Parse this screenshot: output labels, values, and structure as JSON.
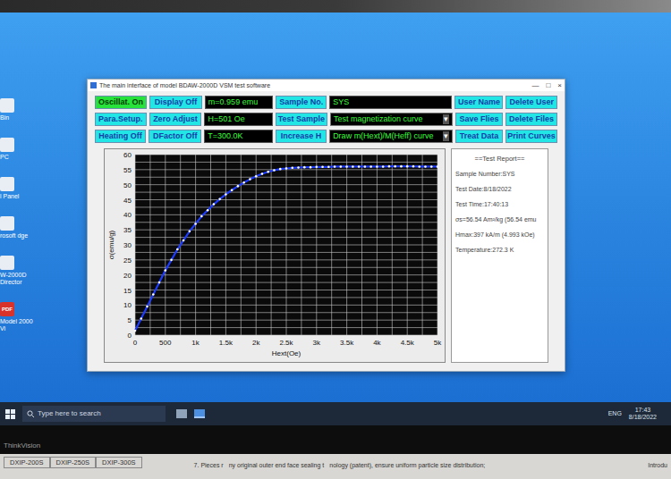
{
  "window": {
    "title": "The main interface of model BDAW-2000D VSM test software",
    "controls": [
      "—",
      "□",
      "×"
    ]
  },
  "desktop_icons": [
    {
      "label": "Bin"
    },
    {
      "label": "PC"
    },
    {
      "label": "l Panel"
    },
    {
      "label": "rosoft dge"
    },
    {
      "label": "W-2000D Director"
    },
    {
      "label": "Model 2000 Vi",
      "badge": "PDF"
    }
  ],
  "toolbar": {
    "rows": [
      [
        {
          "label": "Oscillat. On",
          "kind": "button",
          "active": true
        },
        {
          "label": "Display Off",
          "kind": "button",
          "active": false
        },
        {
          "label": "m=0.959 emu",
          "kind": "value",
          "active": false
        },
        {
          "label": "Sample No.",
          "kind": "button",
          "active": false
        },
        {
          "label": "SYS",
          "kind": "value",
          "active": false
        },
        {
          "label": "User Name",
          "kind": "button",
          "active": false
        },
        {
          "label": "Delete User",
          "kind": "button",
          "active": false
        }
      ],
      [
        {
          "label": "Para.Setup.",
          "kind": "button",
          "active": false
        },
        {
          "label": "Zero Adjust",
          "kind": "button",
          "active": false
        },
        {
          "label": "H=501 Oe",
          "kind": "value",
          "active": false
        },
        {
          "label": "Test Sample",
          "kind": "button",
          "active": false
        },
        {
          "label": "Test magnetization curve",
          "kind": "dropdown",
          "active": false
        },
        {
          "label": "Save Flies",
          "kind": "button",
          "active": false
        },
        {
          "label": "Delete Files",
          "kind": "button",
          "active": false
        }
      ],
      [
        {
          "label": "Heating Off",
          "kind": "button",
          "active": false
        },
        {
          "label": "DFactor Off",
          "kind": "button",
          "active": false
        },
        {
          "label": "T=300.0K",
          "kind": "value",
          "active": false
        },
        {
          "label": "Increase H",
          "kind": "button",
          "active": false
        },
        {
          "label": "Draw m(Hext)/M(Heff) curve",
          "kind": "dropdown",
          "active": false
        },
        {
          "label": "Treat Data",
          "kind": "button",
          "active": false
        },
        {
          "label": "Print Curves",
          "kind": "button",
          "active": false
        }
      ]
    ],
    "dropdown_arrow": "▾"
  },
  "chart": {
    "y_label": "σ(emu/g)",
    "x_label": "Hext(Oe)",
    "y_ticks": [
      {
        "label": "0",
        "value": 0
      },
      {
        "label": "5",
        "value": 5
      },
      {
        "label": "10",
        "value": 10
      },
      {
        "label": "15",
        "value": 15
      },
      {
        "label": "20",
        "value": 20
      },
      {
        "label": "25",
        "value": 25
      },
      {
        "label": "30",
        "value": 30
      },
      {
        "label": "35",
        "value": 35
      },
      {
        "label": "40",
        "value": 40
      },
      {
        "label": "45",
        "value": 45
      },
      {
        "label": "50",
        "value": 50
      },
      {
        "label": "55",
        "value": 55
      },
      {
        "label": "60",
        "value": 60
      }
    ],
    "x_ticks": [
      {
        "label": "0",
        "value": 0
      },
      {
        "label": "500",
        "value": 500
      },
      {
        "label": "1k",
        "value": 1000
      },
      {
        "label": "1.5k",
        "value": 1500
      },
      {
        "label": "2k",
        "value": 2000
      },
      {
        "label": "2.5k",
        "value": 2500
      },
      {
        "label": "3k",
        "value": 3000
      },
      {
        "label": "3.5k",
        "value": 3500
      },
      {
        "label": "4k",
        "value": 4000
      },
      {
        "label": "4.5k",
        "value": 4500
      },
      {
        "label": "5k",
        "value": 5000
      }
    ],
    "series": [
      {
        "name": "m(Hext)",
        "color": "#1e3cff",
        "points": [
          [
            0,
            1.5
          ],
          [
            100,
            5.5
          ],
          [
            200,
            9.5
          ],
          [
            300,
            13.5
          ],
          [
            400,
            17.5
          ],
          [
            500,
            21.5
          ],
          [
            600,
            25
          ],
          [
            700,
            28.5
          ],
          [
            800,
            31.5
          ],
          [
            900,
            34.5
          ],
          [
            1000,
            37
          ],
          [
            1100,
            39.5
          ],
          [
            1200,
            41.5
          ],
          [
            1300,
            43.5
          ],
          [
            1400,
            45.2
          ],
          [
            1500,
            46.8
          ],
          [
            1600,
            48.2
          ],
          [
            1700,
            49.5
          ],
          [
            1800,
            50.7
          ],
          [
            1900,
            51.8
          ],
          [
            2000,
            52.8
          ],
          [
            2100,
            53.6
          ],
          [
            2200,
            54.3
          ],
          [
            2300,
            54.8
          ],
          [
            2400,
            55.2
          ],
          [
            2500,
            55.4
          ],
          [
            2600,
            55.6
          ],
          [
            2700,
            55.7
          ],
          [
            2800,
            55.8
          ],
          [
            2900,
            55.8
          ],
          [
            3000,
            55.9
          ],
          [
            3100,
            55.9
          ],
          [
            3200,
            55.9
          ],
          [
            3300,
            56
          ],
          [
            3400,
            56
          ],
          [
            3500,
            56
          ],
          [
            3600,
            56
          ],
          [
            3700,
            56
          ],
          [
            3800,
            56
          ],
          [
            3900,
            56
          ],
          [
            4000,
            56
          ],
          [
            4100,
            56
          ],
          [
            4200,
            56.1
          ],
          [
            4300,
            56.1
          ],
          [
            4400,
            56.1
          ],
          [
            4500,
            56.1
          ],
          [
            4600,
            56.1
          ],
          [
            4700,
            56
          ],
          [
            4800,
            56
          ],
          [
            4900,
            56
          ],
          [
            5000,
            56
          ]
        ]
      }
    ]
  },
  "report": {
    "title": "==Test Report==",
    "lines": [
      "Sample Number:SYS",
      "Test Date:8/18/2022",
      "Test Time:17:40:13",
      "σs=56.54 Am²/kg (56.54 emu",
      "Hmax:397 kA/m (4.993 kOe)",
      "Temperature:272.3 K"
    ]
  },
  "taskbar": {
    "search_placeholder": "Type here to search",
    "language": "ENG",
    "time": "17:43",
    "date": "8/18/2022"
  },
  "monitor": {
    "brand": "ThinkVision"
  },
  "paper": {
    "cells": [
      "DXIP-200S",
      "DXIP-250S",
      "DXIP-300S"
    ],
    "fragments": [
      "7. Pieces r",
      "ny original outer end face sealing t",
      "nology (patent), ensure uniform particle size distribution;"
    ],
    "side": "Introdu"
  }
}
